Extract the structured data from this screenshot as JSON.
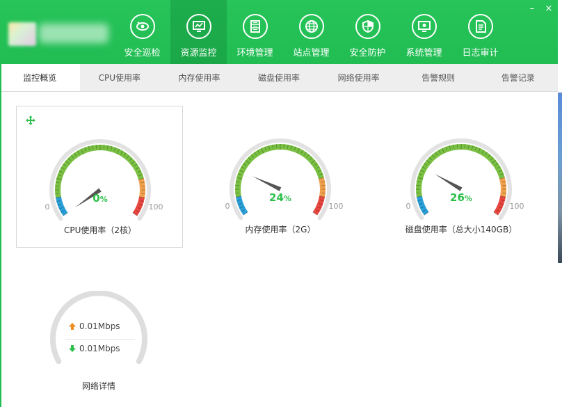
{
  "header": {
    "nav": [
      {
        "label": "安全巡检",
        "icon": "eye-radar-icon"
      },
      {
        "label": "资源监控",
        "icon": "monitor-chart-icon",
        "active": true
      },
      {
        "label": "环境管理",
        "icon": "server-rack-icon"
      },
      {
        "label": "站点管理",
        "icon": "globe-icon"
      },
      {
        "label": "安全防护",
        "icon": "shield-icon"
      },
      {
        "label": "系统管理",
        "icon": "settings-monitor-icon"
      },
      {
        "label": "日志审计",
        "icon": "document-icon"
      }
    ],
    "window_controls": {
      "minimize": "–",
      "close": "×"
    }
  },
  "tabs": [
    {
      "label": "监控概览",
      "active": true
    },
    {
      "label": "CPU使用率"
    },
    {
      "label": "内存使用率"
    },
    {
      "label": "磁盘使用率"
    },
    {
      "label": "网络使用率"
    },
    {
      "label": "告警规则"
    },
    {
      "label": "告警记录"
    }
  ],
  "gauges": [
    {
      "value": 0,
      "min": "0",
      "max": "100",
      "value_text": "0",
      "unit": "%",
      "label": "CPU使用率（2核）"
    },
    {
      "value": 24,
      "min": "0",
      "max": "100",
      "value_text": "24",
      "unit": "%",
      "label": "内存使用率（2G）"
    },
    {
      "value": 26,
      "min": "0",
      "max": "100",
      "value_text": "26",
      "unit": "%",
      "label": "磁盘使用率（总大小140GB）"
    }
  ],
  "network": {
    "upload": "0.01Mbps",
    "download": "0.01Mbps",
    "label": "网络详情"
  },
  "colors": {
    "brand": "#22c55e",
    "gauge_green": "#7ac143",
    "gauge_orange": "#f0a04b",
    "gauge_red": "#e8473f",
    "gauge_blue": "#2a9fd8",
    "value_green": "#2cbf4a",
    "upload_arrow": "#f08a1c",
    "download_arrow": "#2cbf4a"
  }
}
